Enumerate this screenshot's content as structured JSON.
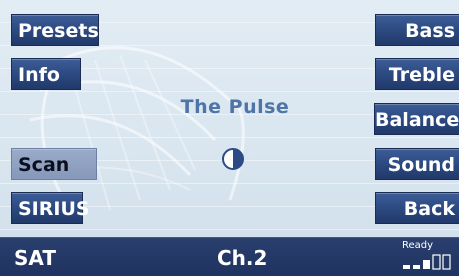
{
  "buttons_left": [
    {
      "label": "Presets",
      "active": false
    },
    {
      "label": "Info",
      "active": false
    },
    {
      "label": "Scan",
      "active": true
    },
    {
      "label": "SIRIUS",
      "active": false
    }
  ],
  "buttons_right": [
    {
      "label": "Bass"
    },
    {
      "label": "Treble"
    },
    {
      "label": "Balance"
    },
    {
      "label": "Sound"
    },
    {
      "label": "Back"
    }
  ],
  "station_name": "The Pulse",
  "status_icon": "half-circle-icon",
  "status_bar": {
    "source": "SAT",
    "channel": "Ch.2",
    "ready_label": "Ready",
    "signal_level": 0.6
  },
  "colors": {
    "button_bg": "#2b487f",
    "button_active_bg": "#8698bb",
    "station_text": "#4f74a8",
    "status_bar_bg": "#1f3260",
    "screen_bg": "#dbe7f0"
  }
}
